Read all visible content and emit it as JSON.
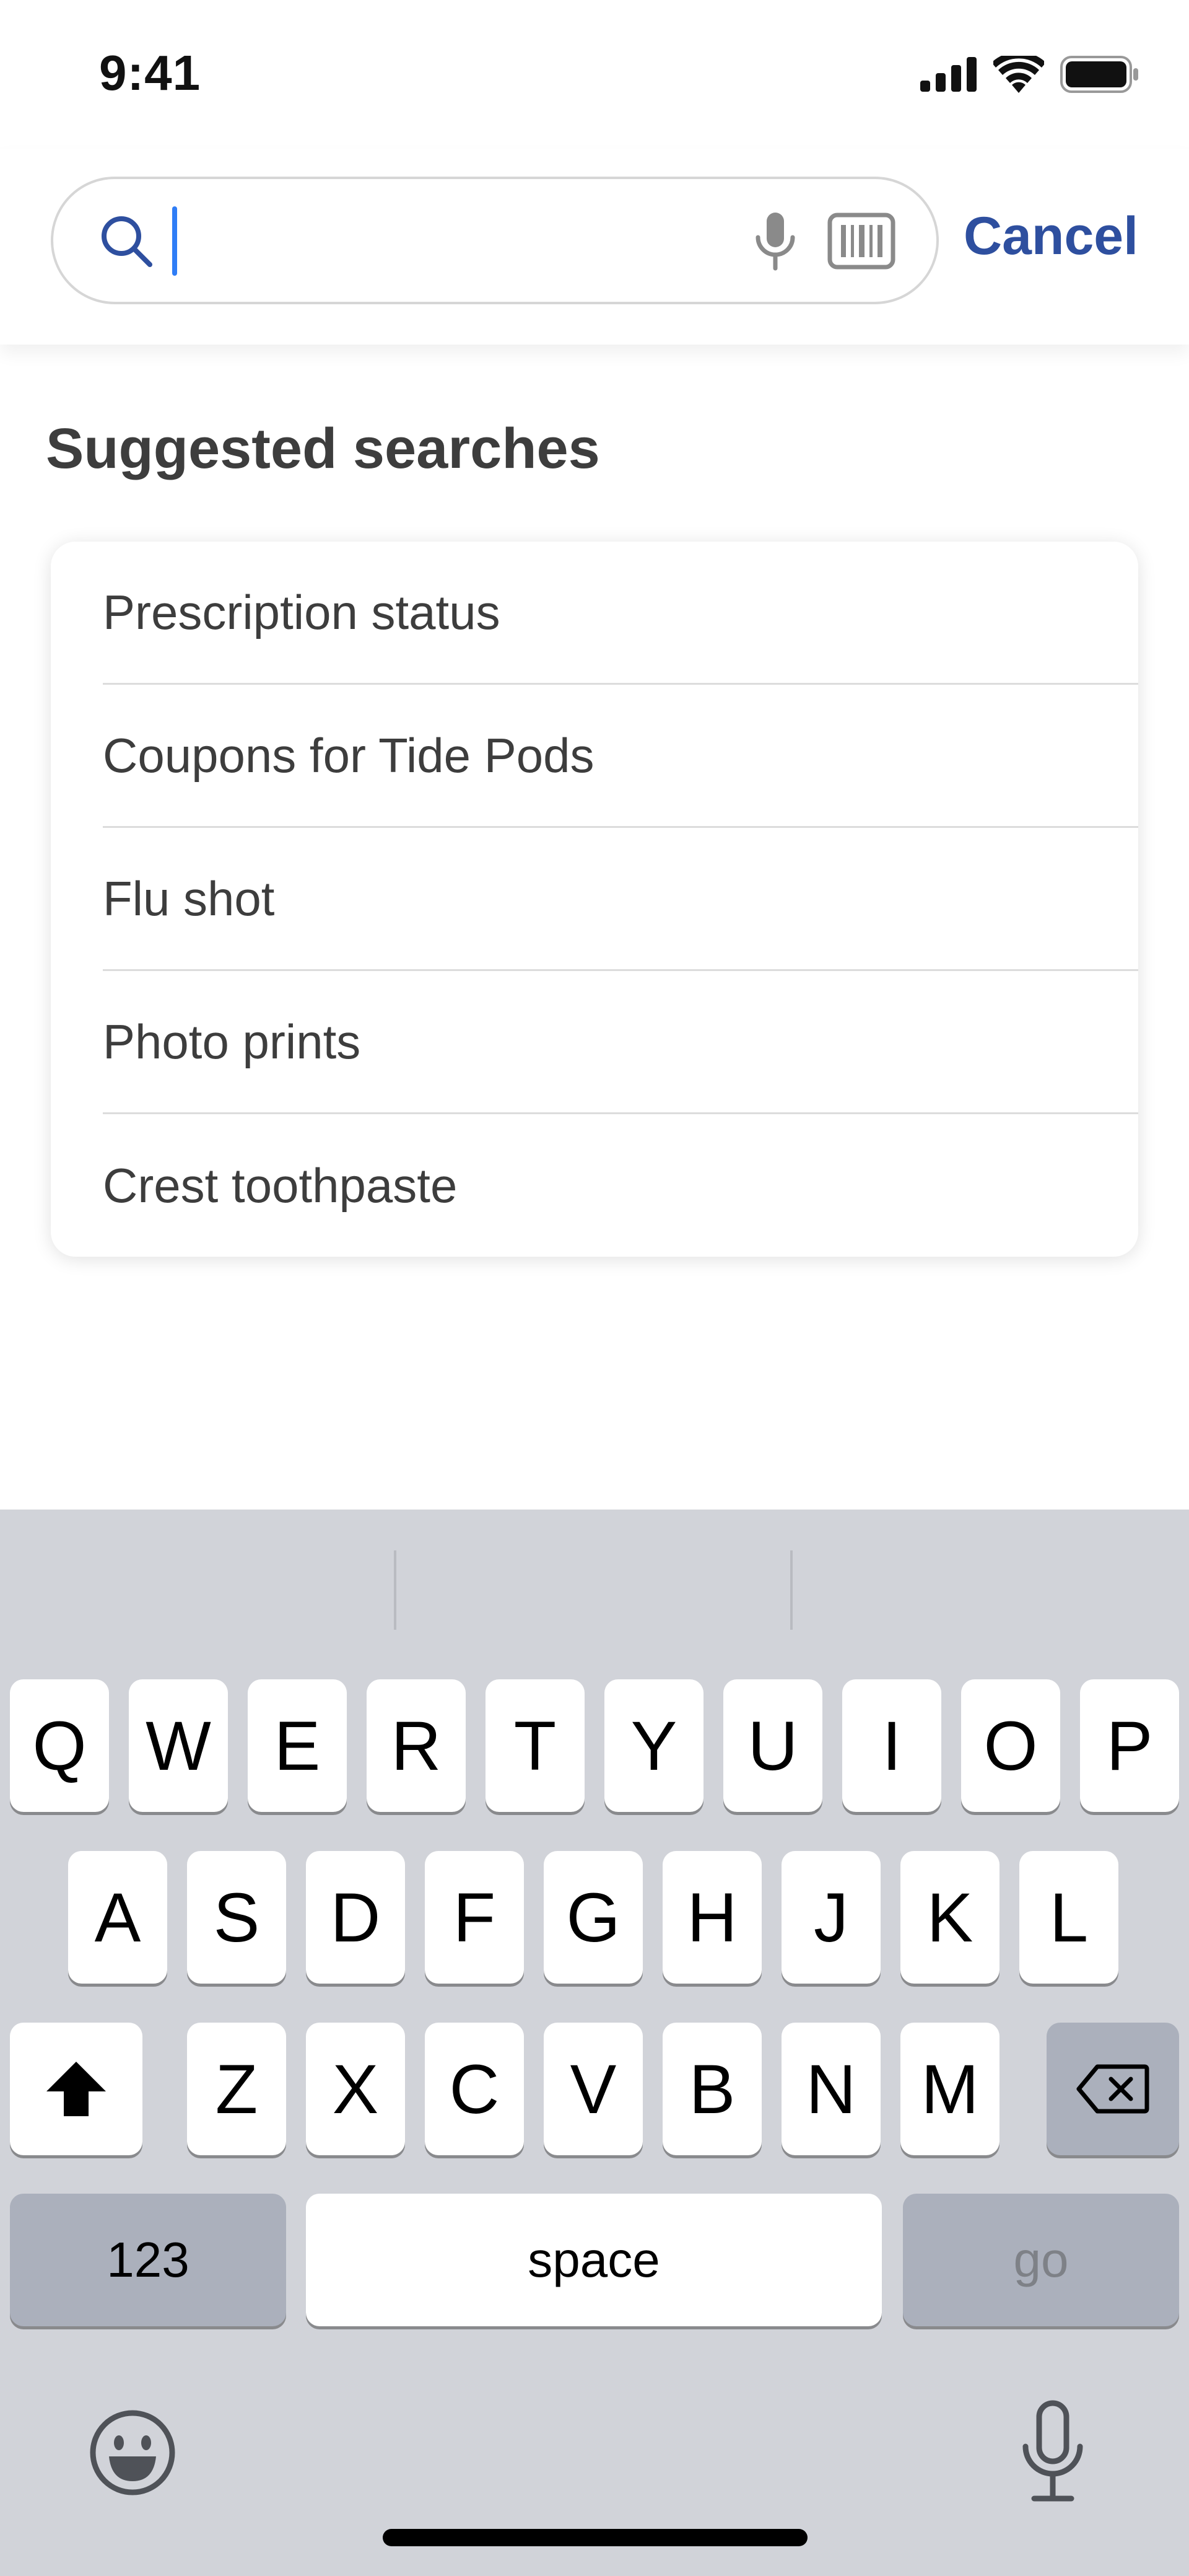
{
  "status_bar": {
    "time": "9:41",
    "icons": [
      "cellular-signal-icon",
      "wifi-icon",
      "battery-icon"
    ]
  },
  "search": {
    "value": "",
    "placeholder": "",
    "icons": [
      "search-icon",
      "microphone-icon",
      "barcode-scanner-icon"
    ],
    "cancel_label": "Cancel"
  },
  "suggestions": {
    "title": "Suggested searches",
    "items": [
      "Prescription status",
      "Coupons for Tide Pods",
      "Flu shot",
      "Photo prints",
      "Crest toothpaste"
    ]
  },
  "keyboard": {
    "row1": [
      "Q",
      "W",
      "E",
      "R",
      "T",
      "Y",
      "U",
      "I",
      "O",
      "P"
    ],
    "row2": [
      "A",
      "S",
      "D",
      "F",
      "G",
      "H",
      "J",
      "K",
      "L"
    ],
    "row3": [
      "Z",
      "X",
      "C",
      "V",
      "B",
      "N",
      "M"
    ],
    "numbers_label": "123",
    "space_label": "space",
    "go_label": "go",
    "icons": [
      "shift-icon",
      "delete-icon",
      "emoji-icon",
      "dictation-icon"
    ]
  },
  "colors": {
    "accent": "#2e4f9f",
    "caret": "#2f7df6",
    "keyboard_bg": "#d1d3d9",
    "text": "#3d3d3d"
  }
}
